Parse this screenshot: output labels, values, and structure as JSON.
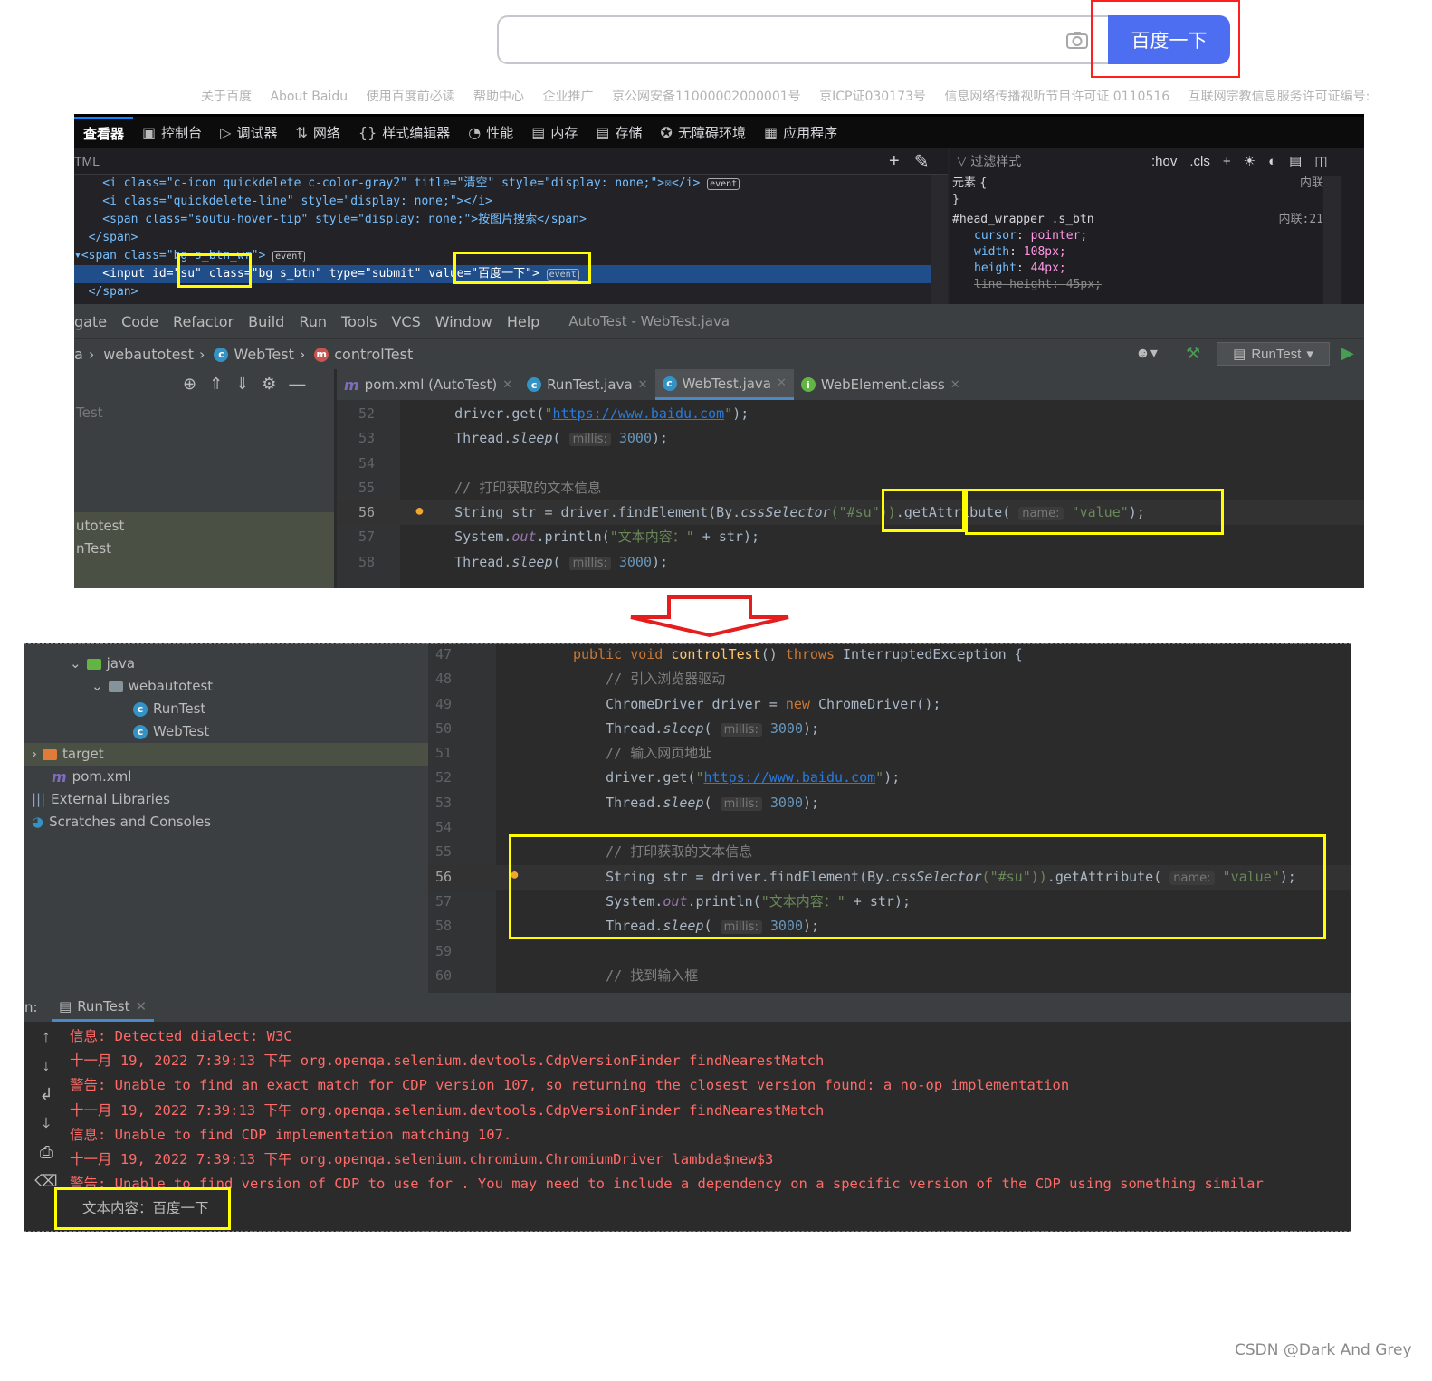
{
  "baidu": {
    "search_value": "",
    "search_button": "百度一下",
    "footer_links": [
      "关于百度",
      "About Baidu",
      "使用百度前必读",
      "帮助中心",
      "企业推广",
      "京公网安备11000002000001号",
      "京ICP证030173号",
      "信息网络传播视听节目许可证 0110516",
      "互联网宗教信息服务许可证编号:"
    ]
  },
  "devtools": {
    "tabs": [
      "查看器",
      "控制台",
      "调试器",
      "网络",
      "样式编辑器",
      "性能",
      "内存",
      "存储",
      "无障碍环境",
      "应用程序"
    ],
    "html_header": "TML",
    "filter_placeholder": "过滤样式",
    "side_tools": [
      ":hov",
      ".cls"
    ],
    "html_lines": [
      "    <i class=\"c-icon quickdelete c-color-gray2\" title=\"清空\" style=\"display: none;\">☒</i>",
      "    <i class=\"quickdelete-line\" style=\"display: none;\"></i>",
      "    <span class=\"soutu-hover-tip\" style=\"display: none;\">按图片搜索</span>",
      "  </span>",
      "▾<span class=\"bg s_btn_wr\">",
      "    <input id=\"su\" class=\"bg s_btn\" type=\"submit\" value=\"百度一下\">",
      "  </span>"
    ],
    "event_badge": "event",
    "rules": {
      "element_label": "元素 {",
      "element_source": "内联",
      "close_brace": "}",
      "selector": "#head_wrapper .s_btn",
      "selector_source": "内联:21",
      "props": [
        {
          "name": "cursor",
          "value": "pointer;"
        },
        {
          "name": "width",
          "value": "108px;"
        },
        {
          "name": "height",
          "value": "44px;"
        },
        {
          "name": "line-height",
          "value": "45px;"
        }
      ]
    }
  },
  "ide_top": {
    "menu": [
      "gate",
      "Code",
      "Refactor",
      "Build",
      "Run",
      "Tools",
      "VCS",
      "Window",
      "Help"
    ],
    "title": "AutoTest - WebTest.java",
    "breadcrumbs": [
      "a",
      "webautotest",
      "WebTest",
      "controlTest"
    ],
    "run_config": "RunTest",
    "project_rows": [
      "Test",
      "",
      "",
      "",
      "",
      "utotest",
      "nTest"
    ],
    "tabs": [
      {
        "label": "pom.xml (AutoTest)",
        "icon": "m"
      },
      {
        "label": "RunTest.java",
        "icon": "c"
      },
      {
        "label": "WebTest.java",
        "icon": "c",
        "active": true
      },
      {
        "label": "WebElement.class",
        "icon": "i"
      }
    ],
    "line_numbers": [
      "52",
      "53",
      "54",
      "55",
      "56",
      "57",
      "58"
    ]
  },
  "ide_bottom": {
    "project_rows": [
      {
        "label": "java",
        "depth": 2,
        "icon": "folder-green",
        "arrow": "v"
      },
      {
        "label": "webautotest",
        "depth": 3,
        "icon": "folder",
        "arrow": "v"
      },
      {
        "label": "RunTest",
        "depth": 5,
        "icon": "c"
      },
      {
        "label": "WebTest",
        "depth": 5,
        "icon": "c"
      },
      {
        "label": "target",
        "depth": 0,
        "icon": "folder-orange",
        "arrow": ">"
      },
      {
        "label": "pom.xml",
        "depth": 1,
        "icon": "m"
      },
      {
        "label": "External Libraries",
        "depth": 0,
        "icon": "lib"
      },
      {
        "label": "Scratches and Consoles",
        "depth": 0,
        "icon": "scratch"
      }
    ],
    "line_numbers": [
      "47",
      "48",
      "49",
      "50",
      "51",
      "52",
      "53",
      "54",
      "55",
      "56",
      "57",
      "58",
      "59",
      "60"
    ],
    "run_label": "n:",
    "run_tab": "RunTest",
    "console": [
      "信息: Detected dialect: W3C",
      "十一月 19, 2022 7:39:13 下午 org.openqa.selenium.devtools.CdpVersionFinder findNearestMatch",
      "警告: Unable to find an exact match for CDP version 107, so returning the closest version found: a no-op implementation",
      "十一月 19, 2022 7:39:13 下午 org.openqa.selenium.devtools.CdpVersionFinder findNearestMatch",
      "信息: Unable to find CDP implementation matching 107.",
      "十一月 19, 2022 7:39:13 下午 org.openqa.selenium.chromium.ChromiumDriver lambda$new$3",
      "警告: Unable to find version of CDP to use for . You may need to include a dependency on a specific version of the CDP using something similar"
    ],
    "console_output": "文本内容：百度一下"
  },
  "code": {
    "get_prefix": "driver.get(",
    "url": "https://www.baidu.com",
    "get_suffix": ");",
    "sleep_prefix": "Thread.",
    "sleep_fn": "sleep",
    "millis_hint": "millis:",
    "sleep_value": "3000",
    "comment_print": "// 打印获取的文本信息",
    "str_decl": "String str = driver.findElement(By.",
    "css_fn": "cssSelector",
    "css_arg": "(\"#su\"))",
    "get_attr": ".getAttribute(",
    "name_hint": "name:",
    "attr_value": "\"value\"",
    "println_prefix": "System.",
    "println_out": "out",
    "println_mid": ".println(",
    "println_str": "\"文本内容：\"",
    "println_suffix": " + str);",
    "method_sig_kw1": "public void ",
    "method_name": "controlTest",
    "method_throws_kw": " throws ",
    "method_exc": "InterruptedException {",
    "comment_driver": "// 引入浏览器驱动",
    "chrome_decl": "ChromeDriver driver = ",
    "new_kw": "new ",
    "chrome_ctor": "ChromeDriver();",
    "comment_url": "// 输入网页地址",
    "comment_input": "// 找到输入框"
  },
  "watermark": "CSDN @Dark And Grey",
  "colors": {
    "baidu_blue": "#4e6ef2",
    "highlight_yellow": "#ffff00",
    "red_box": "#ff1f1f",
    "ide_bg": "#2b2b2b"
  }
}
